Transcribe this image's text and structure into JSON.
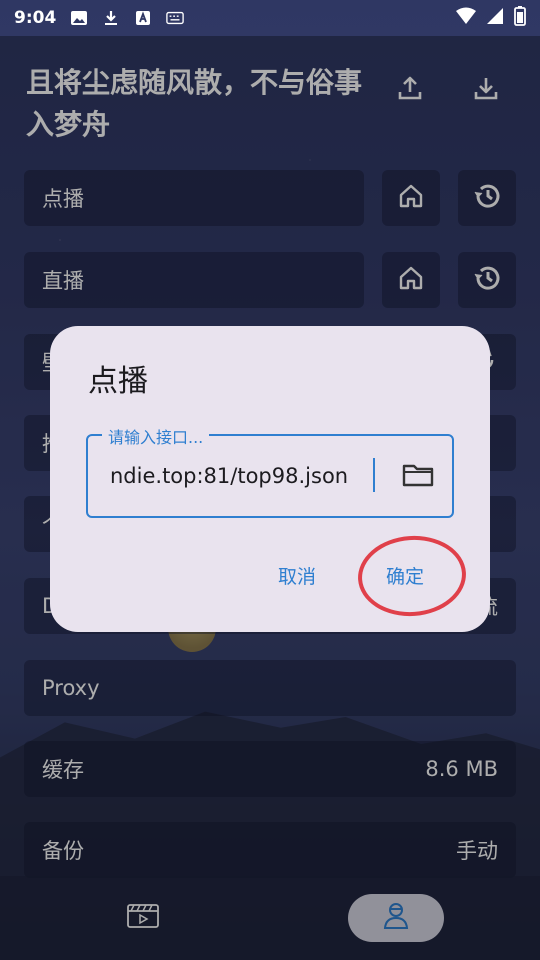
{
  "status_bar": {
    "time": "9:04",
    "icons": [
      "image-icon",
      "download-icon",
      "keyboard-a-icon",
      "keyboard-icon"
    ],
    "right_icons": [
      "wifi-icon",
      "signal-icon",
      "battery-icon"
    ]
  },
  "header": {
    "title": "且将尘虑随风散，不与俗事入梦舟",
    "icons": [
      "upload-icon",
      "download-icon"
    ]
  },
  "settings": {
    "vod_label": "点播",
    "live_label": "直播",
    "row3_partial": "壁",
    "row4_partial": "推",
    "row5_partial": "个",
    "row6_partial": "D",
    "row6_value_partial": "流",
    "proxy_label": "Proxy",
    "cache_label": "缓存",
    "cache_value": "8.6 MB",
    "backup_label": "备份",
    "backup_value": "手动"
  },
  "dialog": {
    "title": "点播",
    "input_label": "请输入接口...",
    "input_value": "ndie.top:81/top98.json",
    "cancel_label": "取消",
    "confirm_label": "确定"
  },
  "nav": {
    "items": [
      "video-icon",
      "settings-user-icon"
    ],
    "active": "settings-user-icon"
  },
  "colors": {
    "accent": "#2f7fd0",
    "dialog_bg": "#e9e3ee",
    "annotation_red": "#e0404a"
  }
}
